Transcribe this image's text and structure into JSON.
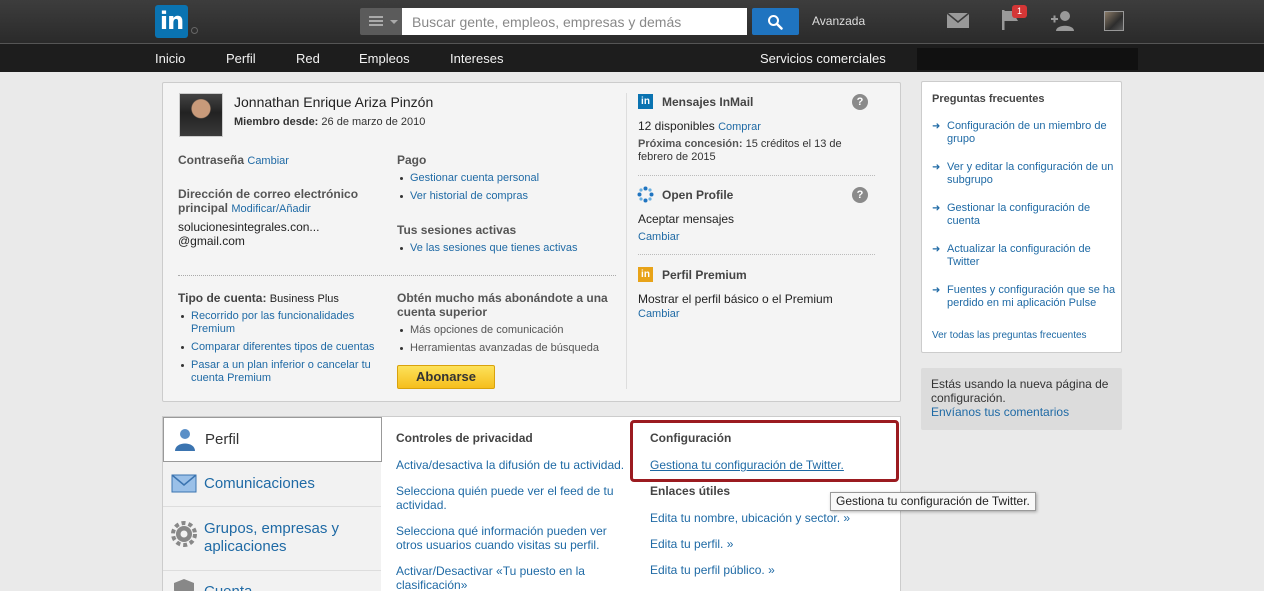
{
  "topbar": {
    "logo_text": "in",
    "search_placeholder": "Buscar gente, empleos, empresas y demás",
    "advanced_label": "Avanzada",
    "flag_badge": "1",
    "icons": [
      "linkedin-logo",
      "menu-icon",
      "search-icon",
      "mail-icon",
      "flag-icon",
      "add-contact-icon",
      "avatar"
    ]
  },
  "nav": {
    "items": [
      "Inicio",
      "Perfil",
      "Red",
      "Empleos",
      "Intereses"
    ],
    "business": "Servicios comerciales"
  },
  "account": {
    "name": "Jonnathan Enrique Ariza Pinzón",
    "member_since_label": "Miembro desde:",
    "member_since_value": "26 de marzo de 2010",
    "password_label": "Contraseña",
    "password_link": "Cambiar",
    "email_label_1": "Dirección de correo electrónico",
    "email_label_2": "principal",
    "email_link": "Modificar/Añadir",
    "email_line1": "solucionesintegrales.con...",
    "email_line2": "@gmail.com",
    "payment_label": "Pago",
    "payment_links": [
      "Gestionar cuenta personal",
      "Ver historial de compras"
    ],
    "sessions_label": "Tus sesiones activas",
    "sessions_link": "Ve las sesiones que tienes activas",
    "account_type_label": "Tipo de cuenta:",
    "account_type_value": "Business Plus",
    "account_links": [
      "Recorrido por las funcionalidades Premium",
      "Comparar diferentes tipos de cuentas",
      "Pasar a un plan inferior o cancelar tu cuenta Premium"
    ],
    "upgrade_title": "Obtén mucho más abonándote a una cuenta superior",
    "upgrade_items": [
      "Más opciones de comunicación",
      "Herramientas avanzadas de búsqueda"
    ],
    "upgrade_button": "Abonarse",
    "inmail_title": "Mensajes InMail",
    "inmail_available": "12 disponibles",
    "inmail_buy": "Comprar",
    "inmail_next_label": "Próxima concesión:",
    "inmail_next_value": "15 créditos el 13 de febrero de 2015",
    "openprofile_title": "Open Profile",
    "openprofile_value": "Aceptar mensajes",
    "openprofile_link": "Cambiar",
    "premium_title": "Perfil Premium",
    "premium_value": "Mostrar el perfil básico o el Premium",
    "premium_link": "Cambiar",
    "help_glyph": "?"
  },
  "tabs": [
    {
      "label": "Perfil"
    },
    {
      "label": "Comunicaciones"
    },
    {
      "label": "Grupos, empresas y aplicaciones"
    },
    {
      "label": "Cuenta"
    }
  ],
  "privacy": {
    "title": "Controles de privacidad",
    "links": [
      "Activa/desactiva la difusión de tu actividad.",
      "Selecciona quién puede ver el feed de tu actividad.",
      "Selecciona qué información pueden ver otros usuarios cuando visitas su perfil.",
      "Activar/Desactivar «Tu puesto en la clasificación»"
    ]
  },
  "config": {
    "title": "Configuración",
    "twitter_link": "Gestiona tu configuración de Twitter.",
    "useful_title": "Enlaces útiles",
    "useful_links": [
      "Edita tu nombre, ubicación y sector. »",
      "Edita tu perfil. »",
      "Edita tu perfil público. »"
    ]
  },
  "tooltip": "Gestiona tu configuración de Twitter.",
  "faq": {
    "title": "Preguntas frecuentes",
    "items": [
      "Configuración de un miembro de grupo",
      "Ver y editar la configuración de un subgrupo",
      "Gestionar la configuración de cuenta",
      "Actualizar la configuración de Twitter",
      "Fuentes y configuración que se ha perdido en mi aplicación Pulse"
    ],
    "all_link": "Ver todas las preguntas frecuentes",
    "arrow_glyph": "➜"
  },
  "feedback": {
    "text": "Estás usando la nueva página de configuración.",
    "link": "Envíanos tus comentarios"
  },
  "colors": {
    "brand": "#0a73b1",
    "link": "#1f6aa5",
    "highlight_border": "#9b1b20",
    "upgrade_button": "#f5be1d"
  }
}
